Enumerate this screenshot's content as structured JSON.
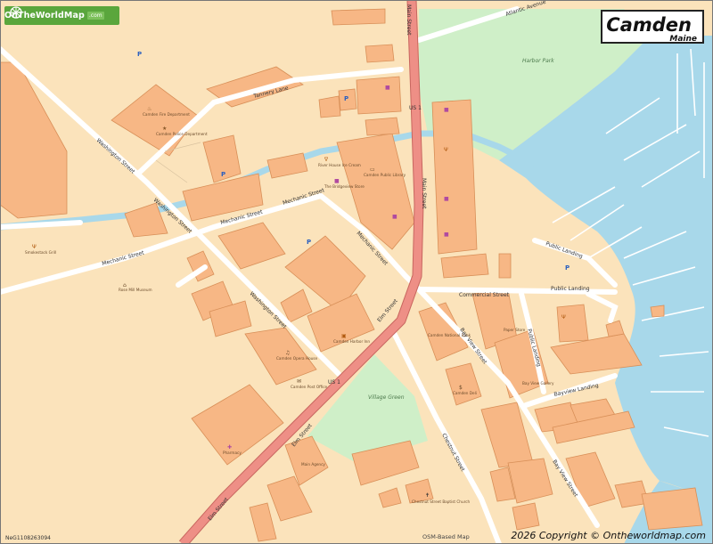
{
  "map": {
    "title": "Camden",
    "subtitle": "Maine",
    "brand": {
      "name": "OnTheWorldMap",
      "suffix": ".com"
    },
    "copyright": "2026 Copyright © Ontheworldmap.com",
    "attribution": "OSM-Based Map",
    "map_id": "NeG1108263094",
    "colors": {
      "land": "#fbe3bb",
      "building": "#f7b785",
      "building_edge": "#d88f58",
      "water": "#a8d8ea",
      "park": "#cfefc8",
      "road_major": "#ee8f86",
      "road_minor": "#ffffff",
      "brand_green": "#5aa63c"
    }
  },
  "streets": [
    {
      "name": "Washington Street"
    },
    {
      "name": "Washington Street"
    },
    {
      "name": "Washington Street"
    },
    {
      "name": "Tannery Lane"
    },
    {
      "name": "Mechanic Street"
    },
    {
      "name": "Mechanic Street"
    },
    {
      "name": "Mechanic Street"
    },
    {
      "name": "Mechanic Street"
    },
    {
      "name": "Main Street"
    },
    {
      "name": "Main Street"
    },
    {
      "name": "Elm Street"
    },
    {
      "name": "Elm Street"
    },
    {
      "name": "Elm Street"
    },
    {
      "name": "US 1"
    },
    {
      "name": "US 1"
    },
    {
      "name": "Commercial Street"
    },
    {
      "name": "Public Landing"
    },
    {
      "name": "Public Landing"
    },
    {
      "name": "Public Landing"
    },
    {
      "name": "Bay View Street"
    },
    {
      "name": "Bay View Street"
    },
    {
      "name": "Bayview Landing"
    },
    {
      "name": "Chestnut Street"
    },
    {
      "name": "Atlantic Avenue"
    }
  ],
  "areas": [
    {
      "name": "Harbor Park"
    },
    {
      "name": "Village Green"
    }
  ],
  "pois": [
    {
      "label": "Camden Fire Department"
    },
    {
      "label": "Camden Police Department"
    },
    {
      "label": "Smokestack Grill"
    },
    {
      "label": "Rose Mill Museum"
    },
    {
      "label": "River House Ice Cream"
    },
    {
      "label": "The Bridgeview Store"
    },
    {
      "label": "Camden Public Library"
    },
    {
      "label": "Camden Opera House"
    },
    {
      "label": "Camden Post Office"
    },
    {
      "label": "Pharmacy"
    },
    {
      "label": "Main Agency"
    },
    {
      "label": "Chestnut Street Baptist Church"
    },
    {
      "label": "Camden Harbor Inn"
    },
    {
      "label": "Camden National Bank"
    },
    {
      "label": "Camden Deli"
    },
    {
      "label": "Paper Store"
    },
    {
      "label": "Bay View Gallery"
    }
  ],
  "parking_label": "P"
}
